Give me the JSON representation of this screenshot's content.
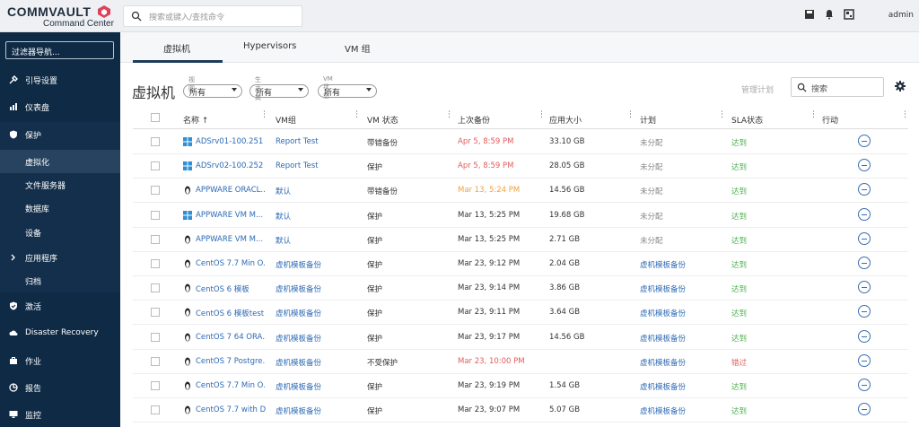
{
  "app": {
    "brand": "COMMVAULT",
    "subtitle": "Command Center",
    "user": "admin"
  },
  "search": {
    "placeholder": "搜索或键入/查找命令"
  },
  "sidebar": {
    "filter_placeholder": "过滤器导航...",
    "items": [
      {
        "label": "引导设置",
        "icon": "wrench-icon"
      },
      {
        "label": "仪表盘",
        "icon": "chart-icon"
      },
      {
        "label": "保护",
        "icon": "shield-icon"
      },
      {
        "label": "虚拟化"
      },
      {
        "label": "文件服务器"
      },
      {
        "label": "数据库"
      },
      {
        "label": "设备"
      },
      {
        "label": "应用程序"
      },
      {
        "label": "归档"
      },
      {
        "label": "激活",
        "icon": "check-shield-icon"
      },
      {
        "label": "Disaster Recovery",
        "icon": "cloud-icon"
      },
      {
        "label": "作业",
        "icon": "briefcase-icon"
      },
      {
        "label": "报告",
        "icon": "report-icon"
      },
      {
        "label": "监控",
        "icon": "monitor-icon"
      }
    ]
  },
  "tabs": [
    "虚拟机",
    "Hypervisors",
    "VM 组"
  ],
  "page": {
    "title": "虚拟机",
    "manage_plan": "管理计划",
    "search_placeholder": "搜索"
  },
  "filters": [
    {
      "label": "视图",
      "value": "所有"
    },
    {
      "label": "生产商",
      "value": "所有"
    },
    {
      "label": "VM 状态",
      "value": "所有"
    }
  ],
  "table": {
    "headers": [
      "名称 ↑",
      "VM组",
      "VM 状态",
      "上次备份",
      "应用大小",
      "计划",
      "SLA状态",
      "行动"
    ],
    "rows": [
      {
        "os": "windows",
        "name": "ADSrv01-100.251",
        "group": "Report Test",
        "status": "带错备份",
        "last": "Apr 5, 8:59 PM",
        "last_color": "red",
        "size": "33.10 GB",
        "plan": "未分配",
        "plan_link": false,
        "sla": "达到",
        "sla_color": "green"
      },
      {
        "os": "windows",
        "name": "ADSrv02-100.252",
        "group": "Report Test",
        "status": "保护",
        "last": "Apr 5, 8:59 PM",
        "last_color": "red",
        "size": "28.05 GB",
        "plan": "未分配",
        "plan_link": false,
        "sla": "达到",
        "sla_color": "green"
      },
      {
        "os": "linux",
        "name": "APPWARE ORACL...",
        "group": "默认",
        "status": "带错备份",
        "last": "Mar 13, 5:24 PM",
        "last_color": "orange",
        "size": "14.56 GB",
        "plan": "未分配",
        "plan_link": false,
        "sla": "达到",
        "sla_color": "green"
      },
      {
        "os": "windows",
        "name": "APPWARE VM M...",
        "group": "默认",
        "status": "保护",
        "last": "Mar 13, 5:25 PM",
        "last_color": "",
        "size": "19.68 GB",
        "plan": "未分配",
        "plan_link": false,
        "sla": "达到",
        "sla_color": "green"
      },
      {
        "os": "linux",
        "name": "APPWARE VM M...",
        "group": "默认",
        "status": "保护",
        "last": "Mar 13, 5:25 PM",
        "last_color": "",
        "size": "2.71 GB",
        "plan": "未分配",
        "plan_link": false,
        "sla": "达到",
        "sla_color": "green"
      },
      {
        "os": "linux",
        "name": "CentOS 7.7 Min O...",
        "group": "虚机模板备份",
        "status": "保护",
        "last": "Mar 23, 9:12 PM",
        "last_color": "",
        "size": "2.04 GB",
        "plan": "虚机模板备份",
        "plan_link": true,
        "sla": "达到",
        "sla_color": "green"
      },
      {
        "os": "linux",
        "name": "CentOS 6 模板",
        "group": "虚机模板备份",
        "status": "保护",
        "last": "Mar 23, 9:14 PM",
        "last_color": "",
        "size": "3.86 GB",
        "plan": "虚机模板备份",
        "plan_link": true,
        "sla": "达到",
        "sla_color": "green"
      },
      {
        "os": "linux",
        "name": "CentOS 6 模板test",
        "group": "虚机模板备份",
        "status": "保护",
        "last": "Mar 23, 9:11 PM",
        "last_color": "",
        "size": "3.64 GB",
        "plan": "虚机模板备份",
        "plan_link": true,
        "sla": "达到",
        "sla_color": "green"
      },
      {
        "os": "linux",
        "name": "CentOS 7 64 ORA...",
        "group": "虚机模板备份",
        "status": "保护",
        "last": "Mar 23, 9:17 PM",
        "last_color": "",
        "size": "14.56 GB",
        "plan": "虚机模板备份",
        "plan_link": true,
        "sla": "达到",
        "sla_color": "green"
      },
      {
        "os": "linux",
        "name": "CentOS 7 Postgre...",
        "group": "虚机模板备份",
        "status": "不受保护",
        "last": "Mar 23, 10:00 PM",
        "last_color": "red",
        "size": "",
        "plan": "虚机模板备份",
        "plan_link": true,
        "sla": "错过",
        "sla_color": "red"
      },
      {
        "os": "linux",
        "name": "CentOS 7.7 Min O...",
        "group": "虚机模板备份",
        "status": "保护",
        "last": "Mar 23, 9:19 PM",
        "last_color": "",
        "size": "1.54 GB",
        "plan": "虚机模板备份",
        "plan_link": true,
        "sla": "达到",
        "sla_color": "green"
      },
      {
        "os": "linux",
        "name": "CentOS 7.7 with D...",
        "group": "虚机模板备份",
        "status": "保护",
        "last": "Mar 23, 9:07 PM",
        "last_color": "",
        "size": "5.07 GB",
        "plan": "虚机模板备份",
        "plan_link": true,
        "sla": "达到",
        "sla_color": "green"
      }
    ]
  },
  "colors": {
    "sidebar": "#0e2a45",
    "link": "#2d6ab5",
    "brand_accent": "#e0405a"
  }
}
